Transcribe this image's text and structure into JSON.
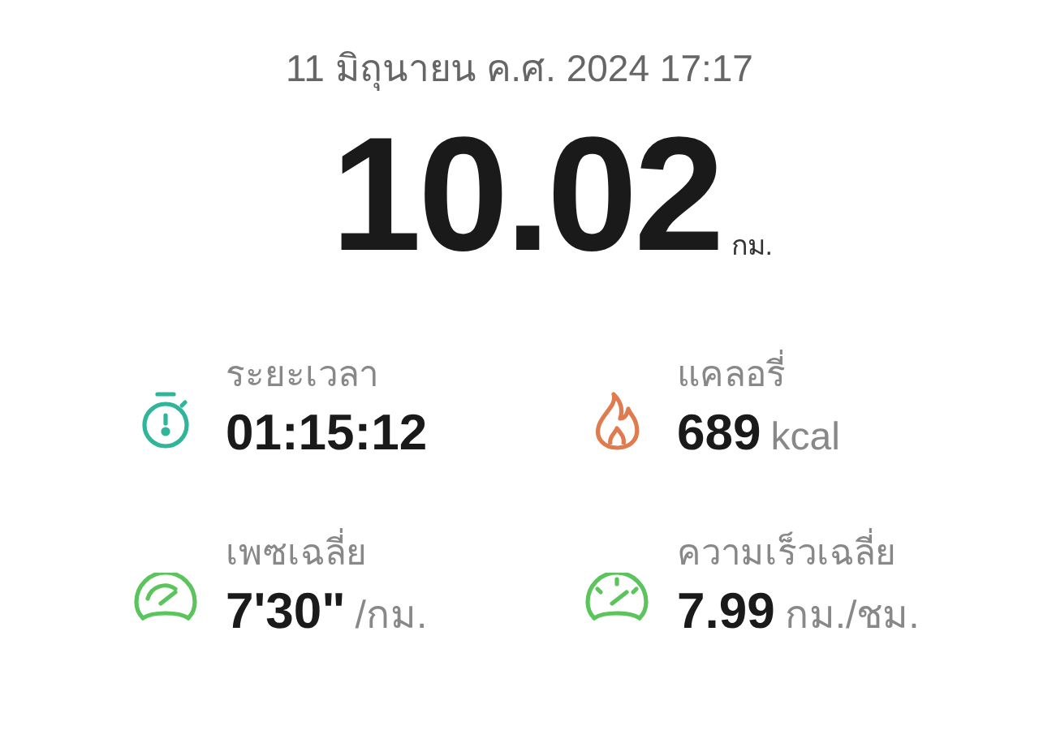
{
  "date": "11 มิถุนายน ค.ศ. 2024 17:17",
  "distance": {
    "value": "10.02",
    "unit": "กม."
  },
  "stats": [
    {
      "kind": "duration",
      "label": "ระยะเวลา",
      "value": "01:15:12"
    },
    {
      "kind": "calories",
      "label": "แคลอรี่",
      "value": "689",
      "unit": "kcal"
    },
    {
      "kind": "pace",
      "label": "เพซเฉลี่ย",
      "value": "7'30\"",
      "unit": "/กม."
    },
    {
      "kind": "speed",
      "label": "ความเร็วเฉลี่ย",
      "value": "7.99",
      "unit": "กม./ชม."
    }
  ]
}
